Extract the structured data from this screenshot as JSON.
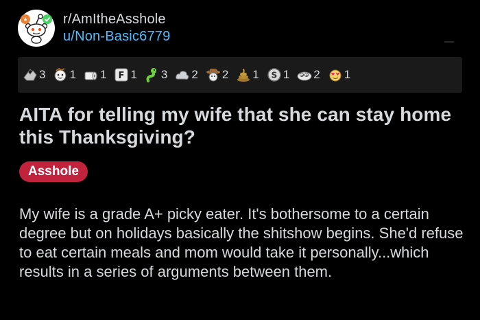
{
  "post": {
    "subreddit": "r/AmItheAsshole",
    "username": "u/Non-Basic6779",
    "title": "AITA for telling my wife that she can stay home this Thanksgiving?",
    "flair": "Asshole",
    "body": "My wife is a grade A+ picky eater. It's bothersome to a certain degree but on holidays basically the shitshow begins. She'd refuse to eat certain meals and mom would take it personally...which results in a series of arguments between them."
  },
  "awards": [
    {
      "icon": "hands-award-icon",
      "count": "3"
    },
    {
      "icon": "face-award-icon",
      "count": "1"
    },
    {
      "icon": "toilet-paper-award-icon",
      "count": "1"
    },
    {
      "icon": "f-key-award-icon",
      "count": "1"
    },
    {
      "icon": "snake-award-icon",
      "count": "3"
    },
    {
      "icon": "cloud-award-icon",
      "count": "2"
    },
    {
      "icon": "cowboy-award-icon",
      "count": "2"
    },
    {
      "icon": "poop-award-icon",
      "count": "1"
    },
    {
      "icon": "s-coin-award-icon",
      "count": "1"
    },
    {
      "icon": "eyes-award-icon",
      "count": "2"
    },
    {
      "icon": "heart-eyes-award-icon",
      "count": "1"
    }
  ],
  "colors": {
    "background": "#000000",
    "text": "#d7dadc",
    "link": "#4fbcff",
    "flair_bg": "#c0233b",
    "awards_bg": "#1a1a1b"
  }
}
